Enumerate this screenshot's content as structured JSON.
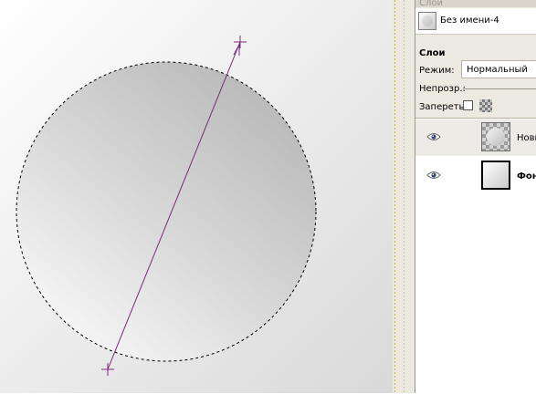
{
  "window": {
    "panel_title": "Слои"
  },
  "image": {
    "name": "Без имени-4"
  },
  "layers_panel": {
    "title": "Слои",
    "mode_label": "Режим:",
    "mode_value": "Нормальный",
    "opacity_label": "Непрозр.:",
    "lock_label": "Запереть:"
  },
  "layers": [
    {
      "name": "Новы",
      "visible": true,
      "thumb": "circle-on-transparent"
    },
    {
      "name": "Фон",
      "visible": true,
      "thumb": "gradient-background"
    }
  ],
  "colors": {
    "guide_line": "#7a2a7a",
    "panel_bg": "#ece9e1",
    "canvas_gradient_light": "#ffffff",
    "canvas_gradient_dark": "#d9d9d9"
  }
}
